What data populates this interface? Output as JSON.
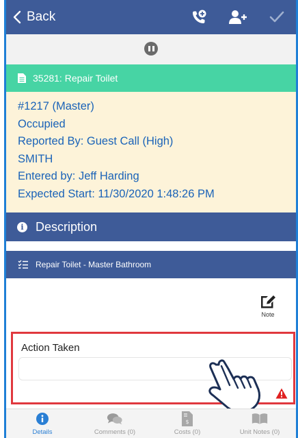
{
  "topbar": {
    "back_label": "Back",
    "icons": [
      "phone-plus-icon",
      "add-user-icon",
      "checkmark-icon"
    ]
  },
  "work_order": {
    "title": "35281: Repair Toilet",
    "lines": [
      "#1217 (Master)",
      "Occupied",
      "Reported By: Guest Call  (High)",
      "SMITH",
      "Entered by: Jeff Harding",
      "Expected Start: 11/30/2020 1:48:26 PM"
    ]
  },
  "description": {
    "label": "Description",
    "task": "Repair Toilet - Master Bathroom"
  },
  "note": {
    "label": "Note"
  },
  "action": {
    "label": "Action Taken",
    "value": "",
    "placeholder": ""
  },
  "tabs": [
    {
      "label": "Details",
      "icon": "info-icon",
      "active": true
    },
    {
      "label": "Comments (0)",
      "icon": "comments-icon",
      "active": false
    },
    {
      "label": "Costs (0)",
      "icon": "costs-icon",
      "active": false
    },
    {
      "label": "Unit Notes (0)",
      "icon": "book-icon",
      "active": false
    }
  ],
  "colors": {
    "header_blue": "#3e5b98",
    "work_order_green": "#47d4a4",
    "detail_background": "#fdf3d9",
    "detail_text": "#1a63b8",
    "highlight_red": "#e0383e",
    "active_tab": "#2a7fd4"
  }
}
